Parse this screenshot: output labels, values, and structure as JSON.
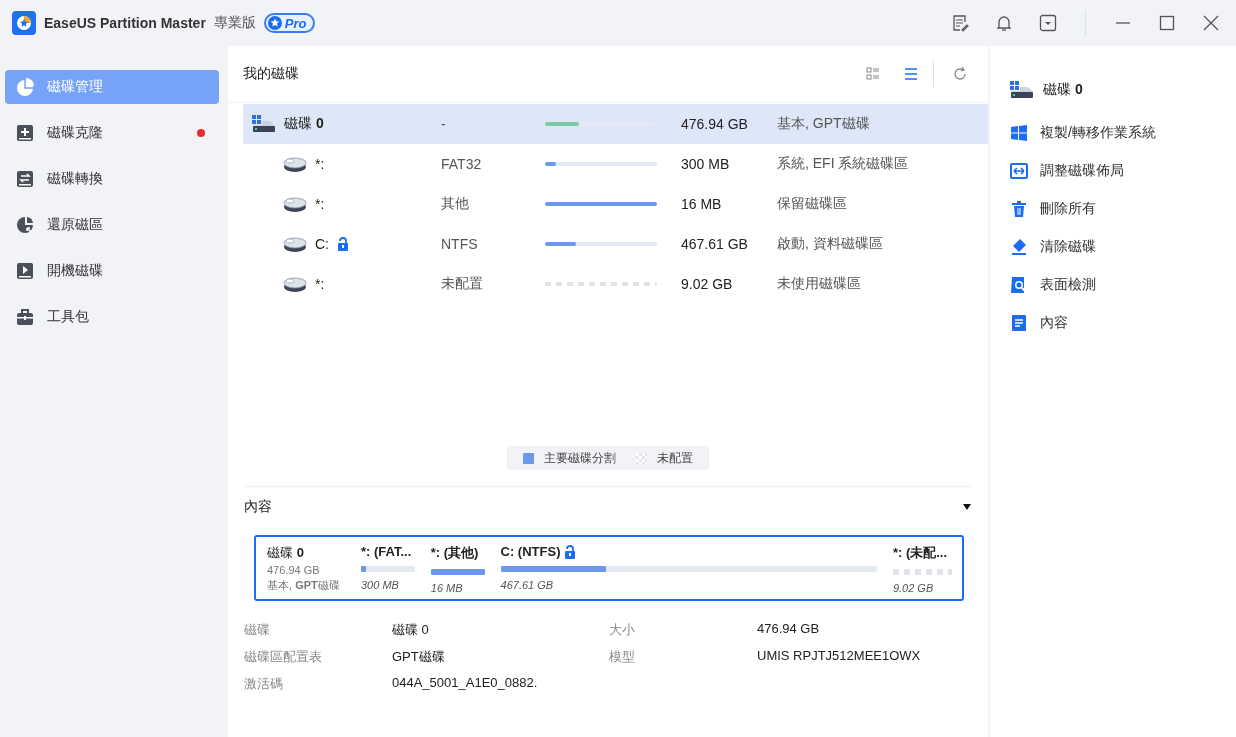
{
  "title_bar": {
    "app_name": "EaseUS Partition Master",
    "edition": "專業版",
    "badge": "Pro"
  },
  "sidebar": {
    "items": [
      {
        "kind": "pie",
        "label": "磁碟管理",
        "selected": true,
        "notification": false
      },
      {
        "kind": "clone",
        "label": "磁碟克隆",
        "selected": false,
        "notification": true
      },
      {
        "kind": "convert",
        "label": "磁碟轉換",
        "selected": false,
        "notification": false
      },
      {
        "kind": "restore",
        "label": "還原磁區",
        "selected": false,
        "notification": false
      },
      {
        "kind": "boot",
        "label": "開機磁碟",
        "selected": false,
        "notification": false
      },
      {
        "kind": "toolkit",
        "label": "工具包",
        "selected": false,
        "notification": false
      }
    ]
  },
  "disk_list": {
    "title": "我的磁碟",
    "view_buttons": [
      {
        "kind": "grid",
        "selected": false
      },
      {
        "kind": "list",
        "selected": true
      }
    ],
    "rows": [
      {
        "name": "磁碟 **0**",
        "selected": true,
        "filesystem": "-",
        "kind": "used",
        "level": 0.3,
        "size": "476.94 GB",
        "type": "基本, GPT磁碟",
        "children": [
          {
            "name": "*:",
            "locked": false,
            "selected": false,
            "filesystem": "FAT32",
            "kind": "partition",
            "level": 0.1,
            "size": "300 MB",
            "type": "系統, EFI 系統磁碟區"
          },
          {
            "name": "*:",
            "locked": false,
            "selected": false,
            "filesystem": "其他",
            "kind": "partition",
            "level": 1,
            "size": "16 MB",
            "type": "保留磁碟區"
          },
          {
            "name": "C:",
            "locked": true,
            "selected": false,
            "filesystem": "NTFS",
            "kind": "partition",
            "level": 0.28,
            "size": "467.61 GB",
            "type": "啟動, 資料磁碟區"
          },
          {
            "name": "*:",
            "locked": false,
            "selected": false,
            "filesystem": "未配置",
            "kind": "unallocated",
            "level": 1,
            "size": "9.02 GB",
            "type": "未使用磁碟區"
          }
        ]
      }
    ]
  },
  "legend": [
    {
      "kind": "primary",
      "label": "主要磁碟分割"
    },
    {
      "kind": "unallocated",
      "label": "未配置"
    }
  ],
  "details": {
    "title": "內容",
    "expanded": true,
    "disk_card": {
      "name": "磁碟 **0**",
      "size": "476.94 GB",
      "type": "基本, **GPT**磁碟",
      "partitions": [
        {
          "name": "*: (FAT...",
          "locked": false,
          "kind": "partition",
          "level": 0.1,
          "size": "300 MB"
        },
        {
          "name": "*: (其他)",
          "locked": false,
          "kind": "partition",
          "level": 1,
          "size": "16 MB"
        },
        {
          "name": "C: (NTFS)",
          "locked": true,
          "kind": "partition",
          "level": 0.28,
          "size": "467.61 GB"
        },
        {
          "name": "*: (未配...",
          "locked": false,
          "kind": "unallocated",
          "level": 1,
          "size": "9.02 GB"
        }
      ]
    },
    "properties": [
      {
        "label": "磁碟",
        "value": "磁碟 0"
      },
      {
        "label": "大小",
        "value": "476.94 GB"
      },
      {
        "label": "磁碟區配置表",
        "value": "GPT磁碟"
      },
      {
        "label": "模型",
        "value": "UMIS RPJTJ512MEE1OWX"
      },
      {
        "label": "激活碼",
        "value": "044A_5001_A1E0_0882."
      }
    ]
  },
  "actions_panel": {
    "header": "磁碟 **0**",
    "actions": [
      {
        "kind": "windows",
        "label": "複製/轉移作業系統"
      },
      {
        "kind": "resize",
        "label": "調整磁碟佈局"
      },
      {
        "kind": "trash",
        "label": "刪除所有"
      },
      {
        "kind": "eraser",
        "label": "清除磁碟"
      },
      {
        "kind": "scan",
        "label": "表面檢測"
      },
      {
        "kind": "document",
        "label": "內容"
      }
    ]
  }
}
